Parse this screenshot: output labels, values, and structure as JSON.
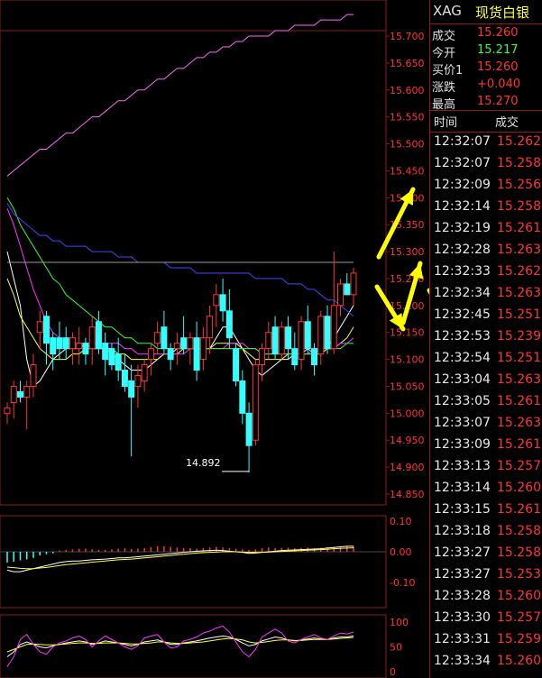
{
  "header": {
    "symbol": "XAG",
    "name": "现货白银"
  },
  "quote": [
    {
      "label": "成交",
      "value": "15.260",
      "color": "#ff3333"
    },
    {
      "label": "今开",
      "value": "15.217",
      "color": "#33ff33"
    },
    {
      "label": "买价1",
      "value": "15.260",
      "color": "#ff3333"
    },
    {
      "label": "涨跌",
      "value": "+0.040",
      "color": "#ff3333"
    },
    {
      "label": "最高",
      "value": "15.270",
      "color": "#ff3333"
    }
  ],
  "trades_header": {
    "time": "时间",
    "price": "成交"
  },
  "trades": [
    {
      "time": "12:32:07",
      "price": "15.262"
    },
    {
      "time": "12:32:07",
      "price": "15.258"
    },
    {
      "time": "12:32:09",
      "price": "15.256"
    },
    {
      "time": "12:32:14",
      "price": "15.258"
    },
    {
      "time": "12:32:19",
      "price": "15.261"
    },
    {
      "time": "12:32:28",
      "price": "15.263"
    },
    {
      "time": "12:32:33",
      "price": "15.262"
    },
    {
      "time": "12:32:34",
      "price": "15.263"
    },
    {
      "time": "12:32:45",
      "price": "15.251"
    },
    {
      "time": "12:32:53",
      "price": "15.239"
    },
    {
      "time": "12:32:54",
      "price": "15.251"
    },
    {
      "time": "12:33:04",
      "price": "15.263"
    },
    {
      "time": "12:33:05",
      "price": "15.261"
    },
    {
      "time": "12:33:07",
      "price": "15.263"
    },
    {
      "time": "12:33:09",
      "price": "15.261"
    },
    {
      "time": "12:33:13",
      "price": "15.257"
    },
    {
      "time": "12:33:14",
      "price": "15.260"
    },
    {
      "time": "12:33:15",
      "price": "15.261"
    },
    {
      "time": "12:33:18",
      "price": "15.258"
    },
    {
      "time": "12:33:27",
      "price": "15.258"
    },
    {
      "time": "12:33:27",
      "price": "15.253"
    },
    {
      "time": "12:33:28",
      "price": "15.260"
    },
    {
      "time": "12:33:30",
      "price": "15.257"
    },
    {
      "time": "12:33:31",
      "price": "15.259"
    },
    {
      "time": "12:33:34",
      "price": "15.260"
    }
  ],
  "chart_data": {
    "type": "candlestick",
    "price_axis": {
      "ticks": [
        "15.700",
        "15.650",
        "15.600",
        "15.550",
        "15.500",
        "15.450",
        "15.400",
        "15.350",
        "15.300",
        "15.250",
        "15.200",
        "15.150",
        "15.100",
        "15.050",
        "15.000",
        "14.950",
        "14.900",
        "14.850"
      ],
      "ylim": [
        14.85,
        15.7
      ]
    },
    "low_annotation": "14.892",
    "macd_axis": {
      "ticks": [
        "0.10",
        "0.00",
        "-0.10"
      ],
      "ylim": [
        -0.1,
        0.1
      ]
    },
    "kdj_axis": {
      "ticks": [
        "100",
        "50",
        "0"
      ],
      "ylim": [
        0,
        100
      ]
    },
    "candles": [
      {
        "o": 15.0,
        "h": 15.02,
        "l": 14.98,
        "c": 15.01
      },
      {
        "o": 15.02,
        "h": 15.06,
        "l": 14.99,
        "c": 15.05
      },
      {
        "o": 15.04,
        "h": 15.06,
        "l": 15.02,
        "c": 15.03
      },
      {
        "o": 15.03,
        "h": 15.06,
        "l": 14.97,
        "c": 15.05
      },
      {
        "o": 15.05,
        "h": 15.11,
        "l": 15.03,
        "c": 15.09
      },
      {
        "o": 15.15,
        "h": 15.19,
        "l": 15.12,
        "c": 15.17
      },
      {
        "o": 15.18,
        "h": 15.19,
        "l": 15.09,
        "c": 15.13
      },
      {
        "o": 15.14,
        "h": 15.15,
        "l": 15.08,
        "c": 15.11
      },
      {
        "o": 15.14,
        "h": 15.17,
        "l": 15.1,
        "c": 15.12
      },
      {
        "o": 15.14,
        "h": 15.16,
        "l": 15.1,
        "c": 15.12
      },
      {
        "o": 15.12,
        "h": 15.15,
        "l": 15.09,
        "c": 15.14
      },
      {
        "o": 15.12,
        "h": 15.16,
        "l": 15.09,
        "c": 15.13
      },
      {
        "o": 15.13,
        "h": 15.14,
        "l": 15.09,
        "c": 15.11
      },
      {
        "o": 15.12,
        "h": 15.18,
        "l": 15.09,
        "c": 15.16
      },
      {
        "o": 15.17,
        "h": 15.19,
        "l": 15.11,
        "c": 15.12
      },
      {
        "o": 15.13,
        "h": 15.15,
        "l": 15.07,
        "c": 15.1
      },
      {
        "o": 15.12,
        "h": 15.13,
        "l": 15.08,
        "c": 15.09
      },
      {
        "o": 15.11,
        "h": 15.14,
        "l": 15.06,
        "c": 15.08
      },
      {
        "o": 15.08,
        "h": 15.11,
        "l": 15.04,
        "c": 15.05
      },
      {
        "o": 15.06,
        "h": 15.09,
        "l": 14.92,
        "c": 15.03
      },
      {
        "o": 15.05,
        "h": 15.09,
        "l": 15.01,
        "c": 15.07
      },
      {
        "o": 15.06,
        "h": 15.1,
        "l": 15.04,
        "c": 15.09
      },
      {
        "o": 15.1,
        "h": 15.13,
        "l": 15.07,
        "c": 15.12
      },
      {
        "o": 15.13,
        "h": 15.17,
        "l": 15.11,
        "c": 15.15
      },
      {
        "o": 15.16,
        "h": 15.19,
        "l": 15.11,
        "c": 15.12
      },
      {
        "o": 15.12,
        "h": 15.13,
        "l": 15.08,
        "c": 15.1
      },
      {
        "o": 15.12,
        "h": 15.15,
        "l": 15.09,
        "c": 15.13
      },
      {
        "o": 15.14,
        "h": 15.18,
        "l": 15.11,
        "c": 15.12
      },
      {
        "o": 15.12,
        "h": 15.15,
        "l": 15.09,
        "c": 15.14
      },
      {
        "o": 15.14,
        "h": 15.17,
        "l": 15.06,
        "c": 15.08
      },
      {
        "o": 15.1,
        "h": 15.16,
        "l": 15.08,
        "c": 15.14
      },
      {
        "o": 15.14,
        "h": 15.2,
        "l": 15.11,
        "c": 15.18
      },
      {
        "o": 15.2,
        "h": 15.24,
        "l": 15.16,
        "c": 15.22
      },
      {
        "o": 15.22,
        "h": 15.25,
        "l": 15.17,
        "c": 15.19
      },
      {
        "o": 15.19,
        "h": 15.23,
        "l": 15.12,
        "c": 15.14
      },
      {
        "o": 15.12,
        "h": 15.13,
        "l": 15.05,
        "c": 15.06
      },
      {
        "o": 15.06,
        "h": 15.08,
        "l": 14.98,
        "c": 15.0
      },
      {
        "o": 15.0,
        "h": 15.02,
        "l": 14.89,
        "c": 14.94
      },
      {
        "o": 14.95,
        "h": 15.1,
        "l": 14.94,
        "c": 15.09
      },
      {
        "o": 15.09,
        "h": 15.13,
        "l": 15.06,
        "c": 15.12
      },
      {
        "o": 15.12,
        "h": 15.17,
        "l": 15.1,
        "c": 15.15
      },
      {
        "o": 15.16,
        "h": 15.18,
        "l": 15.1,
        "c": 15.11
      },
      {
        "o": 15.11,
        "h": 15.17,
        "l": 15.1,
        "c": 15.16
      },
      {
        "o": 15.16,
        "h": 15.18,
        "l": 15.1,
        "c": 15.12
      },
      {
        "o": 15.12,
        "h": 15.15,
        "l": 15.08,
        "c": 15.09
      },
      {
        "o": 15.1,
        "h": 15.18,
        "l": 15.08,
        "c": 15.17
      },
      {
        "o": 15.17,
        "h": 15.2,
        "l": 15.11,
        "c": 15.12
      },
      {
        "o": 15.12,
        "h": 15.13,
        "l": 15.07,
        "c": 15.09
      },
      {
        "o": 15.11,
        "h": 15.19,
        "l": 15.09,
        "c": 15.18
      },
      {
        "o": 15.18,
        "h": 15.2,
        "l": 15.11,
        "c": 15.12
      },
      {
        "o": 15.12,
        "h": 15.3,
        "l": 15.11,
        "c": 15.2
      },
      {
        "o": 15.2,
        "h": 15.25,
        "l": 15.18,
        "c": 15.24
      },
      {
        "o": 15.24,
        "h": 15.26,
        "l": 15.22,
        "c": 15.22
      },
      {
        "o": 15.22,
        "h": 15.27,
        "l": 15.2,
        "c": 15.26
      }
    ],
    "macd_hist": [
      -0.035,
      -0.032,
      -0.028,
      -0.025,
      -0.02,
      -0.012,
      -0.008,
      -0.005,
      0.004,
      0.006,
      0.008,
      0.01,
      0.01,
      0.008,
      0.006,
      0.006,
      0.008,
      0.01,
      0.012,
      0.009,
      0.01,
      0.012,
      0.015,
      0.018,
      0.018,
      0.016,
      0.014,
      0.012,
      0.012,
      0.01,
      0.012,
      0.014,
      0.016,
      0.014,
      0.012,
      0.01,
      0.008,
      0.006,
      0.008,
      0.012,
      0.014,
      0.012,
      0.013,
      0.014,
      0.012,
      0.013,
      0.014,
      0.012,
      0.013,
      0.015,
      0.016,
      0.017,
      0.018,
      0.019
    ],
    "macd_dif": [
      -0.06,
      -0.065,
      -0.065,
      -0.06,
      -0.055,
      -0.05,
      -0.045,
      -0.04,
      -0.035,
      -0.032,
      -0.03,
      -0.03,
      -0.028,
      -0.026,
      -0.025,
      -0.024,
      -0.022,
      -0.02,
      -0.02,
      -0.018,
      -0.016,
      -0.014,
      -0.012,
      -0.01,
      -0.008,
      -0.006,
      -0.004,
      -0.002,
      0,
      0.002,
      0.003,
      0.004,
      0.005,
      0.004,
      0.002,
      0,
      -0.002,
      -0.005,
      -0.004,
      -0.002,
      0,
      0.002,
      0.004,
      0.005,
      0.006,
      0.007,
      0.008,
      0.009,
      0.01,
      0.012,
      0.014,
      0.016,
      0.018,
      0.018
    ],
    "macd_dea": [
      -0.05,
      -0.052,
      -0.054,
      -0.055,
      -0.055,
      -0.053,
      -0.051,
      -0.048,
      -0.045,
      -0.042,
      -0.04,
      -0.038,
      -0.036,
      -0.034,
      -0.032,
      -0.03,
      -0.028,
      -0.026,
      -0.025,
      -0.024,
      -0.022,
      -0.02,
      -0.018,
      -0.016,
      -0.014,
      -0.012,
      -0.01,
      -0.008,
      -0.006,
      -0.004,
      -0.003,
      -0.002,
      -0.001,
      0,
      0,
      0,
      -0.001,
      -0.002,
      -0.002,
      -0.002,
      -0.001,
      0,
      0.001,
      0.002,
      0.003,
      0.004,
      0.005,
      0.006,
      0.007,
      0.008,
      0.01,
      0.011,
      0.012,
      0.013
    ],
    "kdj_k": [
      30,
      40,
      55,
      60,
      55,
      50,
      48,
      52,
      55,
      58,
      60,
      62,
      60,
      55,
      58,
      62,
      60,
      58,
      55,
      52,
      55,
      60,
      62,
      64,
      60,
      55,
      55,
      58,
      60,
      62,
      65,
      68,
      70,
      72,
      70,
      65,
      58,
      52,
      55,
      62,
      66,
      70,
      68,
      64,
      62,
      64,
      66,
      68,
      66,
      65,
      68,
      70,
      70,
      72
    ],
    "kdj_d": [
      40,
      45,
      50,
      55,
      56,
      55,
      54,
      54,
      55,
      56,
      57,
      58,
      58,
      57,
      57,
      58,
      58,
      58,
      57,
      56,
      56,
      57,
      58,
      60,
      60,
      58,
      57,
      57,
      58,
      59,
      60,
      62,
      64,
      66,
      67,
      66,
      64,
      60,
      58,
      59,
      61,
      63,
      64,
      64,
      63,
      63,
      64,
      65,
      65,
      65,
      66,
      67,
      68,
      69
    ],
    "kdj_j": [
      10,
      30,
      65,
      75,
      55,
      40,
      35,
      50,
      58,
      62,
      68,
      72,
      65,
      50,
      62,
      72,
      65,
      58,
      50,
      45,
      52,
      68,
      72,
      75,
      60,
      48,
      50,
      62,
      65,
      70,
      78,
      82,
      88,
      92,
      80,
      60,
      40,
      30,
      45,
      70,
      78,
      86,
      78,
      62,
      58,
      65,
      70,
      75,
      68,
      65,
      72,
      78,
      76,
      80
    ],
    "ma_lines": [
      {
        "color": "#ffffff",
        "values": [
          15.3,
          15.25,
          15.2,
          15.1,
          15.05,
          15.06,
          15.08,
          15.1,
          15.11,
          15.12,
          15.12,
          15.12,
          15.13,
          15.12,
          15.12,
          15.12,
          15.11,
          15.1,
          15.09,
          15.08,
          15.08,
          15.08,
          15.09,
          15.1,
          15.11,
          15.11,
          15.12,
          15.12,
          15.12,
          15.12,
          15.12,
          15.12,
          15.14,
          15.16,
          15.16,
          15.14,
          15.12,
          15.1,
          15.08,
          15.07,
          15.08,
          15.09,
          15.1,
          15.1,
          15.11,
          15.11,
          15.12,
          15.11,
          15.11,
          15.12,
          15.14,
          15.16,
          15.18,
          15.2
        ]
      },
      {
        "color": "#ffff33",
        "values": [
          15.25,
          15.22,
          15.18,
          15.16,
          15.14,
          15.12,
          15.11,
          15.1,
          15.1,
          15.1,
          15.11,
          15.11,
          15.12,
          15.12,
          15.12,
          15.12,
          15.12,
          15.11,
          15.11,
          15.1,
          15.1,
          15.1,
          15.1,
          15.1,
          15.11,
          15.11,
          15.11,
          15.12,
          15.12,
          15.12,
          15.12,
          15.12,
          15.13,
          15.13,
          15.13,
          15.13,
          15.12,
          15.11,
          15.1,
          15.1,
          15.1,
          15.1,
          15.1,
          15.11,
          15.11,
          15.11,
          15.11,
          15.11,
          15.11,
          15.12,
          15.12,
          15.13,
          15.14,
          15.16
        ]
      },
      {
        "color": "#ff33ff",
        "values": [
          15.38,
          15.35,
          15.31,
          15.27,
          15.23,
          15.2,
          15.17,
          15.15,
          15.14,
          15.13,
          15.13,
          15.13,
          15.13,
          15.13,
          15.13,
          15.13,
          15.13,
          15.13,
          15.12,
          15.12,
          15.11,
          15.11,
          15.11,
          15.11,
          15.11,
          15.11,
          15.11,
          15.11,
          15.12,
          15.12,
          15.12,
          15.12,
          15.12,
          15.12,
          15.13,
          15.13,
          15.13,
          15.12,
          15.12,
          15.11,
          15.11,
          15.11,
          15.11,
          15.11,
          15.11,
          15.11,
          15.11,
          15.12,
          15.12,
          15.12,
          15.12,
          15.13,
          15.13,
          15.14
        ]
      },
      {
        "color": "#33ff33",
        "values": [
          15.4,
          15.38,
          15.35,
          15.33,
          15.31,
          15.29,
          15.27,
          15.25,
          15.24,
          15.22,
          15.21,
          15.2,
          15.19,
          15.18,
          15.17,
          15.16,
          15.16,
          15.15,
          15.14,
          15.14,
          15.13,
          15.13,
          15.13,
          15.12,
          15.12,
          15.12,
          15.12,
          15.12,
          15.12,
          15.12,
          15.12,
          15.12,
          15.12,
          15.12,
          15.12,
          15.12,
          15.12,
          15.12,
          15.12,
          15.11,
          15.11,
          15.11,
          15.11,
          15.11,
          15.11,
          15.11,
          15.11,
          15.11,
          15.12,
          15.12,
          15.12,
          15.12,
          15.13,
          15.13
        ]
      },
      {
        "color": "#4444ff",
        "values": [
          15.39,
          15.37,
          15.36,
          15.35,
          15.34,
          15.33,
          15.33,
          15.32,
          15.32,
          15.31,
          15.31,
          15.31,
          15.31,
          15.3,
          15.3,
          15.3,
          15.3,
          15.29,
          15.29,
          15.29,
          15.28,
          15.28,
          15.28,
          15.28,
          15.28,
          15.27,
          15.27,
          15.27,
          15.27,
          15.26,
          15.26,
          15.26,
          15.26,
          15.26,
          15.26,
          15.26,
          15.26,
          15.26,
          15.25,
          15.25,
          15.25,
          15.25,
          15.25,
          15.24,
          15.24,
          15.24,
          15.23,
          15.23,
          15.22,
          15.21,
          15.21,
          15.2,
          15.19,
          15.18
        ]
      },
      {
        "color": "#999999",
        "values": [
          15.28,
          15.28,
          15.28,
          15.28,
          15.28,
          15.28,
          15.28,
          15.28,
          15.28,
          15.28,
          15.28,
          15.28,
          15.28,
          15.28,
          15.28,
          15.28,
          15.28,
          15.28,
          15.28,
          15.28,
          15.28,
          15.28,
          15.28,
          15.28,
          15.28,
          15.28,
          15.28,
          15.28,
          15.28,
          15.28,
          15.28,
          15.28,
          15.28,
          15.28,
          15.28,
          15.28,
          15.28,
          15.28,
          15.28,
          15.28,
          15.28,
          15.28,
          15.28,
          15.28,
          15.28,
          15.28,
          15.28,
          15.28,
          15.28,
          15.28,
          15.28,
          15.28,
          15.28,
          15.28
        ]
      },
      {
        "color": "#ff66ff",
        "values": [
          15.44,
          15.45,
          15.46,
          15.47,
          15.48,
          15.49,
          15.49,
          15.5,
          15.51,
          15.52,
          15.52,
          15.53,
          15.54,
          15.55,
          15.55,
          15.56,
          15.57,
          15.58,
          15.58,
          15.59,
          15.6,
          15.6,
          15.61,
          15.62,
          15.62,
          15.63,
          15.64,
          15.64,
          15.65,
          15.66,
          15.66,
          15.67,
          15.67,
          15.68,
          15.68,
          15.69,
          15.69,
          15.7,
          15.7,
          15.7,
          15.7,
          15.71,
          15.71,
          15.71,
          15.72,
          15.72,
          15.72,
          15.72,
          15.73,
          15.73,
          15.73,
          15.73,
          15.74,
          15.74
        ]
      }
    ],
    "colors": {
      "up": "#ff3333",
      "down": "#33ffff",
      "axis": "#8a1a1a",
      "annotation_arrow": "#ffff00"
    }
  }
}
